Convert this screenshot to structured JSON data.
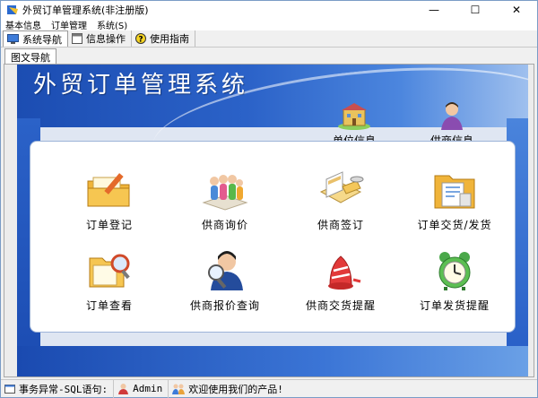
{
  "window": {
    "title": "外贸订单管理系统(非注册版)",
    "minimize": "—",
    "maximize": "☐",
    "close": "✕"
  },
  "menu": {
    "items": [
      {
        "label": "基本信息"
      },
      {
        "label": "订单管理"
      },
      {
        "label": "系统(S)"
      }
    ]
  },
  "toolbar": {
    "tabs": [
      {
        "label": "系统导航",
        "icon": "monitor-icon"
      },
      {
        "label": "信息操作",
        "icon": "window-icon"
      },
      {
        "label": "使用指南",
        "icon": "help-icon"
      }
    ]
  },
  "subtab": {
    "label": "图文导航"
  },
  "hero": {
    "title": "外贸订单管理系统"
  },
  "top_links": [
    {
      "label": "单位信息",
      "icon": "building-icon"
    },
    {
      "label": "供商信息",
      "icon": "person-icon"
    }
  ],
  "nav": [
    {
      "label": "订单登记",
      "icon": "folder-pencil-icon"
    },
    {
      "label": "供商询价",
      "icon": "people-group-icon"
    },
    {
      "label": "供商签订",
      "icon": "book-pen-icon"
    },
    {
      "label": "订单交货/发货",
      "icon": "folder-document-icon"
    },
    {
      "label": "订单查看",
      "icon": "folder-search-icon"
    },
    {
      "label": "供商报价查询",
      "icon": "person-magnifier-icon"
    },
    {
      "label": "供商交货提醒",
      "icon": "alarm-bell-icon"
    },
    {
      "label": "订单发货提醒",
      "icon": "alarm-clock-icon"
    }
  ],
  "status": {
    "message": "事务异常-SQL语句:",
    "user": "Admin",
    "welcome": "欢迎使用我们的产品!"
  },
  "colors": {
    "banner": "#2b62c8",
    "panel_border": "#9db4d8"
  }
}
